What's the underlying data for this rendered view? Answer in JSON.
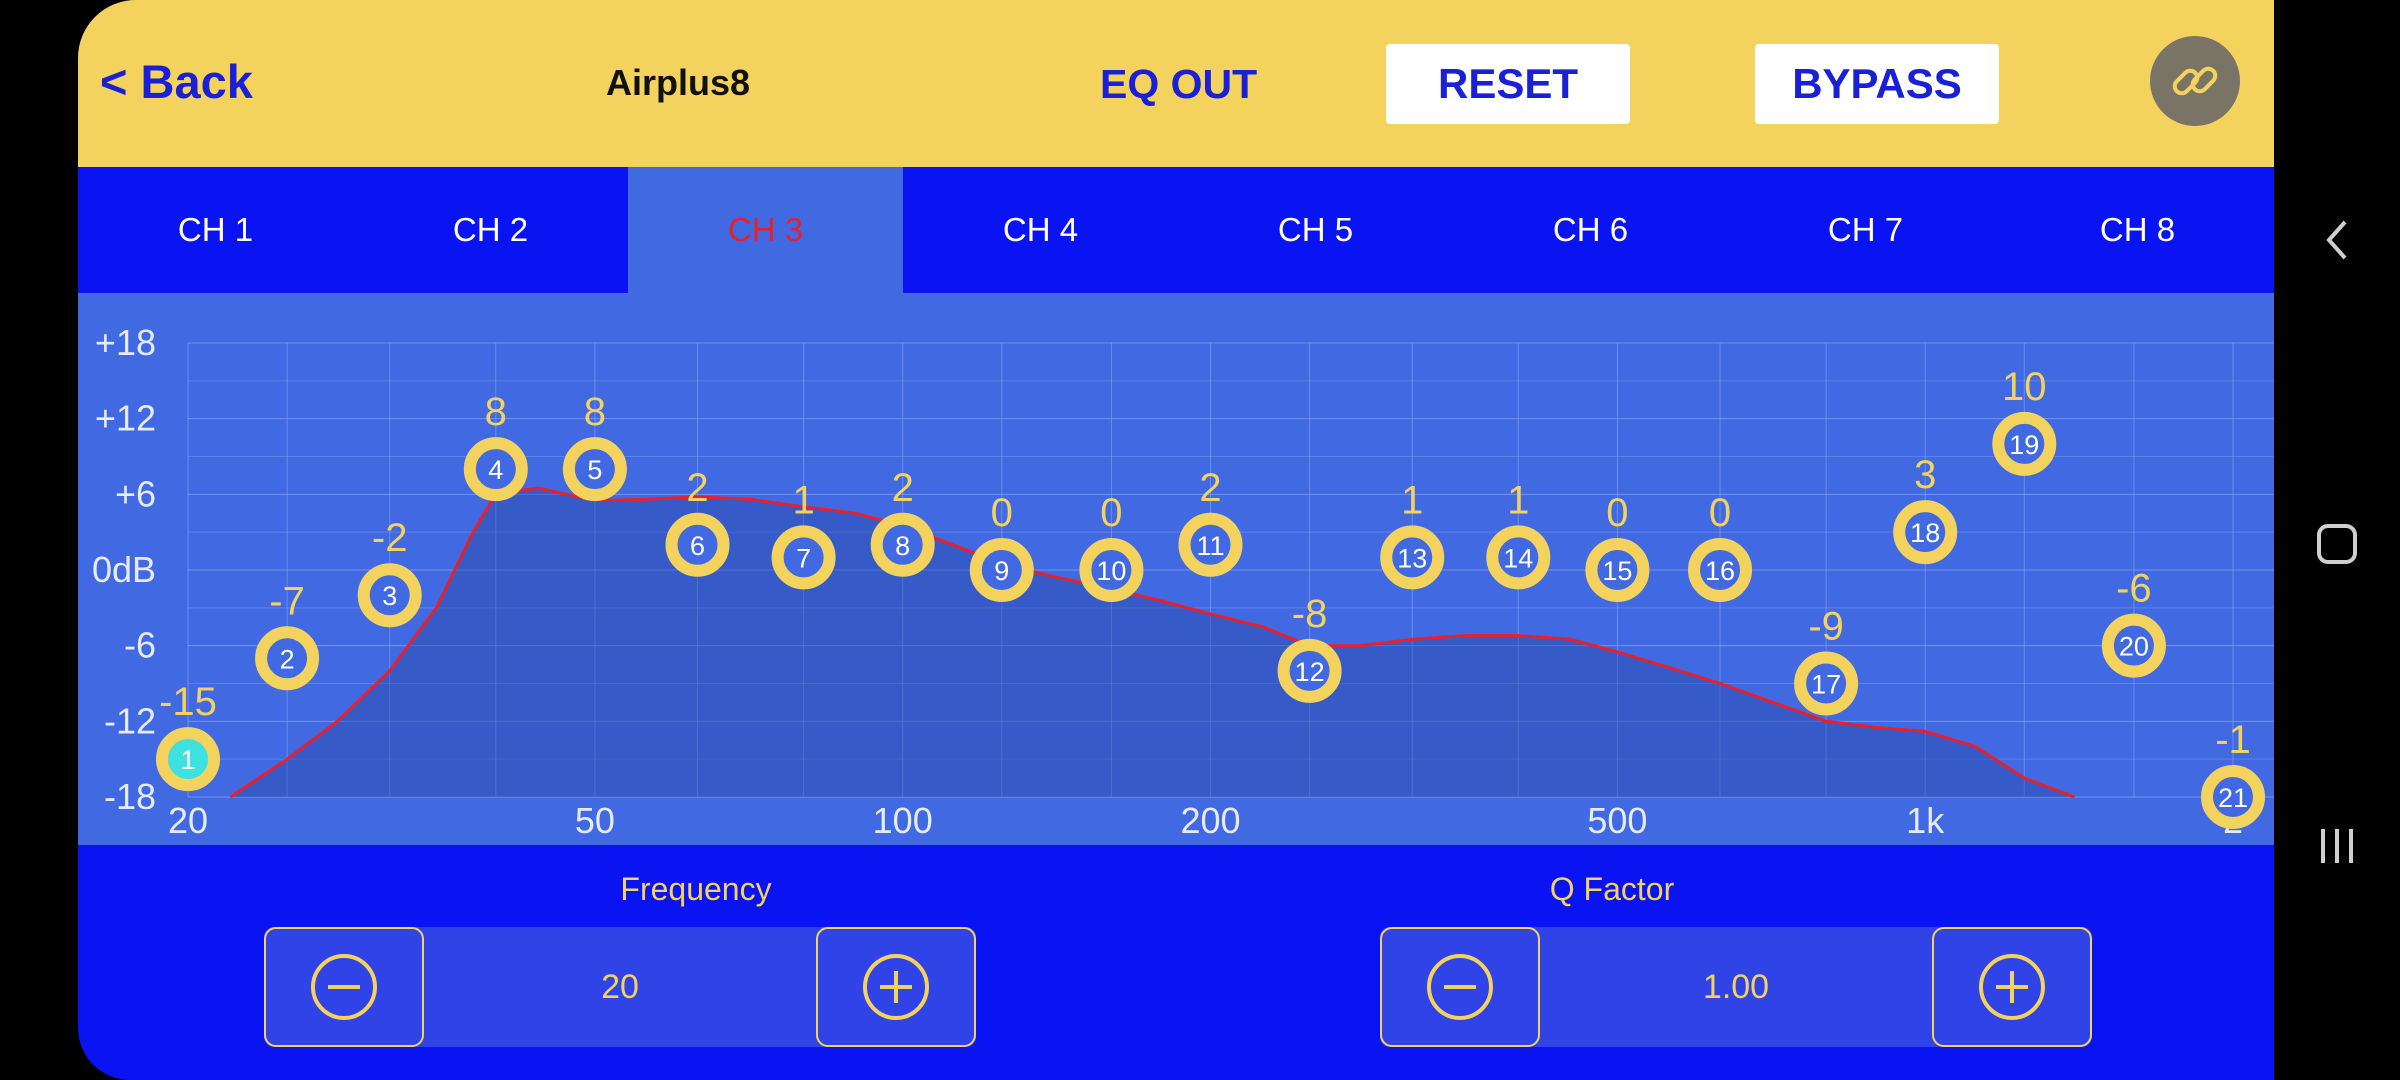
{
  "header": {
    "back_label": "< Back",
    "device_name": "Airplus8",
    "eq_out_label": "EQ OUT",
    "reset_label": "RESET",
    "bypass_label": "BYPASS",
    "link_icon": "link-icon"
  },
  "tabs": [
    {
      "label": "CH 1",
      "active": false
    },
    {
      "label": "CH 2",
      "active": false
    },
    {
      "label": "CH 3",
      "active": true
    },
    {
      "label": "CH 4",
      "active": false
    },
    {
      "label": "CH 5",
      "active": false
    },
    {
      "label": "CH 6",
      "active": false
    },
    {
      "label": "CH 7",
      "active": false
    },
    {
      "label": "CH 8",
      "active": false
    }
  ],
  "chart_data": {
    "type": "line",
    "y_ticks": [
      "+18",
      "+12",
      "+6",
      "0dB",
      "-6",
      "-12",
      "-18"
    ],
    "y_range": [
      -18,
      18
    ],
    "x_ticks": [
      "20",
      "50",
      "100",
      "200",
      "500",
      "1k",
      "2"
    ],
    "x_scale": "log",
    "grid": true,
    "bands": [
      {
        "id": "1",
        "freq": 20,
        "gain_label": "-15",
        "gain": -15,
        "selected": true
      },
      {
        "id": "2",
        "freq": 25,
        "gain_label": "-7",
        "gain": -7
      },
      {
        "id": "3",
        "freq": 31.5,
        "gain_label": "-2",
        "gain": -2
      },
      {
        "id": "4",
        "freq": 40,
        "gain_label": "8",
        "gain": 8
      },
      {
        "id": "5",
        "freq": 50,
        "gain_label": "8",
        "gain": 8
      },
      {
        "id": "6",
        "freq": 63,
        "gain_label": "2",
        "gain": 2
      },
      {
        "id": "7",
        "freq": 80,
        "gain_label": "1",
        "gain": 1
      },
      {
        "id": "8",
        "freq": 100,
        "gain_label": "2",
        "gain": 2
      },
      {
        "id": "9",
        "freq": 125,
        "gain_label": "0",
        "gain": 0
      },
      {
        "id": "10",
        "freq": 160,
        "gain_label": "0",
        "gain": 0
      },
      {
        "id": "11",
        "freq": 200,
        "gain_label": "2",
        "gain": 2
      },
      {
        "id": "12",
        "freq": 250,
        "gain_label": "-8",
        "gain": -8
      },
      {
        "id": "13",
        "freq": 315,
        "gain_label": "1",
        "gain": 1
      },
      {
        "id": "14",
        "freq": 400,
        "gain_label": "1",
        "gain": 1
      },
      {
        "id": "15",
        "freq": 500,
        "gain_label": "0",
        "gain": 0
      },
      {
        "id": "16",
        "freq": 630,
        "gain_label": "0",
        "gain": 0
      },
      {
        "id": "17",
        "freq": 800,
        "gain_label": "-9",
        "gain": -9
      },
      {
        "id": "18",
        "freq": 1000,
        "gain_label": "3",
        "gain": 3
      },
      {
        "id": "19",
        "freq": 1250,
        "gain_label": "10",
        "gain": 10
      },
      {
        "id": "20",
        "freq": 1600,
        "gain_label": "-6",
        "gain": -6
      },
      {
        "id": "21",
        "freq": 2000,
        "gain_label": "-1",
        "gain": -18
      }
    ],
    "response_curve": [
      [
        22,
        -18
      ],
      [
        25,
        -15
      ],
      [
        28,
        -12
      ],
      [
        31.5,
        -8
      ],
      [
        35,
        -3
      ],
      [
        38,
        3
      ],
      [
        40,
        6
      ],
      [
        44,
        6.5
      ],
      [
        50,
        5.5
      ],
      [
        56,
        5.6
      ],
      [
        63,
        5.8
      ],
      [
        71,
        5.6
      ],
      [
        80,
        5
      ],
      [
        90,
        4.5
      ],
      [
        100,
        3.5
      ],
      [
        112,
        2
      ],
      [
        125,
        0.5
      ],
      [
        140,
        -0.5
      ],
      [
        160,
        -1.5
      ],
      [
        180,
        -2.5
      ],
      [
        200,
        -3.5
      ],
      [
        225,
        -4.5
      ],
      [
        250,
        -6
      ],
      [
        280,
        -6
      ],
      [
        315,
        -5.5
      ],
      [
        355,
        -5.2
      ],
      [
        400,
        -5.2
      ],
      [
        450,
        -5.5
      ],
      [
        500,
        -6.5
      ],
      [
        560,
        -7.7
      ],
      [
        630,
        -9
      ],
      [
        710,
        -10.5
      ],
      [
        800,
        -12
      ],
      [
        900,
        -12.5
      ],
      [
        1000,
        -12.8
      ],
      [
        1120,
        -14
      ],
      [
        1250,
        -16.5
      ],
      [
        1400,
        -18
      ]
    ],
    "colors": {
      "curve": "#e8202a",
      "band_ring": "#f3d35e",
      "band_fill": "#4169e1",
      "selected_fill": "#3ee0e0",
      "label": "#f3d35e",
      "axis_text": "#e6ebff"
    }
  },
  "controls": {
    "frequency_label": "Frequency",
    "frequency_value": "20",
    "qfactor_label": "Q Factor",
    "qfactor_value": "1.00",
    "minus_icon": "minus-circle-icon",
    "plus_icon": "plus-circle-icon"
  },
  "navbar": {
    "back_icon": "nav-back-icon",
    "home_icon": "nav-home-icon",
    "recents_icon": "nav-recents-icon"
  }
}
